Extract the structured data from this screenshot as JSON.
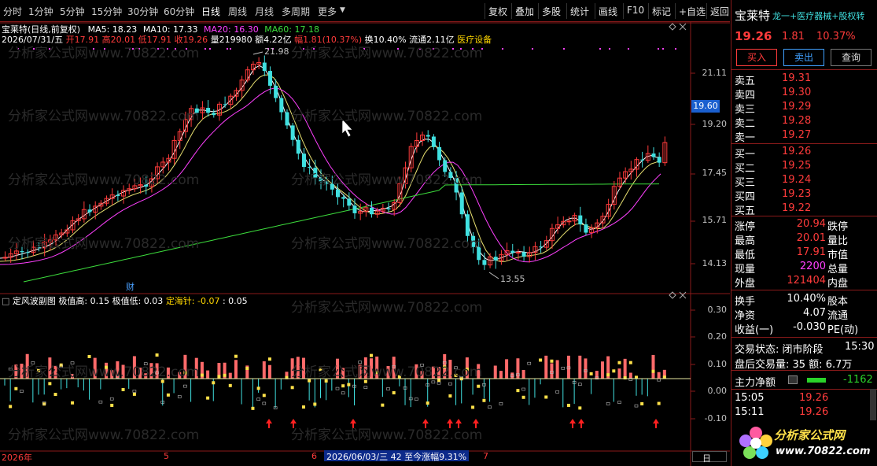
{
  "toolbar": {
    "periods": [
      "分时",
      "1分钟",
      "5分钟",
      "15分钟",
      "30分钟",
      "60分钟",
      "日线",
      "周线",
      "月线",
      "多周期",
      "更多"
    ],
    "active_period": "日线",
    "more_arrow": "▼",
    "buttons": [
      "复权",
      "叠加",
      "多股",
      "统计",
      "画线",
      "F10",
      "标记",
      "+自选",
      "返回"
    ]
  },
  "chart": {
    "title_line": "宝莱特(日线,前复权)",
    "ma5": "MA5: 18.23",
    "ma10": "MA10: 17.33",
    "ma20": "MA20: 16.30",
    "ma60": "MA60: 17.18",
    "date": "2026/07/31/五",
    "open": "开17.91",
    "high": "高20.01",
    "low": "低17.91",
    "close": "收19.26",
    "volume": "量219980",
    "amount": "额4.22亿",
    "change_range": "幅1.81(10.37%)",
    "turnover": "换10.40%",
    "float_cap": "流通2.11亿",
    "industry": "医疗设备",
    "price_axis": [
      "21.11",
      "19.20",
      "17.45",
      "15.71",
      "14.13"
    ],
    "current_price_tag": "19.60",
    "high_annotation": "21.98",
    "low_annotation": "13.55",
    "cai_marker": "财",
    "watermark": "分析家公式网www.70822.com"
  },
  "indicator": {
    "title": "定风波副图",
    "max_label": "极值高: 0.15",
    "min_label": "极值低: 0.03",
    "needle_label": "定海针: -0.07",
    "needle_label2": ": 0.05",
    "axis": [
      "0.30",
      "0.20",
      "0.10",
      "0.00",
      "-0.10"
    ]
  },
  "timeline": {
    "year": "2026年",
    "m5": "5",
    "m6": "6",
    "m7": "7",
    "highlight": "2026/06/03/三 42 至今涨幅9.31%",
    "day_btn": "日"
  },
  "quote": {
    "name": "宝莱特",
    "tags": "龙一+医疗器械+股权转",
    "price": "19.26",
    "change": "1.81",
    "pct": "10.37%",
    "buy_btn": "买入",
    "sell_btn": "卖出",
    "query_btn": "查询",
    "asks": [
      {
        "label": "卖五",
        "price": "19.31"
      },
      {
        "label": "卖四",
        "price": "19.30"
      },
      {
        "label": "卖三",
        "price": "19.29"
      },
      {
        "label": "卖二",
        "price": "19.28"
      },
      {
        "label": "卖一",
        "price": "19.27"
      }
    ],
    "bids": [
      {
        "label": "买一",
        "price": "19.26"
      },
      {
        "label": "买二",
        "price": "19.25"
      },
      {
        "label": "买三",
        "price": "19.24"
      },
      {
        "label": "买四",
        "price": "19.23"
      },
      {
        "label": "买五",
        "price": "19.22"
      }
    ],
    "stats": [
      {
        "label": "涨停",
        "value": "20.94",
        "label2": "跌停"
      },
      {
        "label": "最高",
        "value": "20.01",
        "label2": "量比"
      },
      {
        "label": "最低",
        "value": "17.91",
        "label2": "市值"
      },
      {
        "label": "现量",
        "value": "2200",
        "label2": "总量"
      },
      {
        "label": "外盘",
        "value": "121404",
        "label2": "内盘"
      }
    ],
    "stats2": [
      {
        "label": "换手",
        "value": "10.40%",
        "label2": "股本"
      },
      {
        "label": "净资",
        "value": "4.07",
        "label2": "流通"
      },
      {
        "label": "收益(一)",
        "value": "-0.030",
        "label2": "PE(动)"
      }
    ],
    "trade_state": "交易状态: 闭市阶段",
    "trade_time": "15:30",
    "after_hours": "盘后交易量: 35  额: 6.7万",
    "main_net_label": "主力净额",
    "main_net_value": "-1162",
    "ticks": [
      {
        "time": "15:05",
        "price": "19.26"
      },
      {
        "time": "15:11",
        "price": "19.26"
      }
    ],
    "logo_text": "分析家公式网",
    "logo_url": "www.70822.com"
  }
}
